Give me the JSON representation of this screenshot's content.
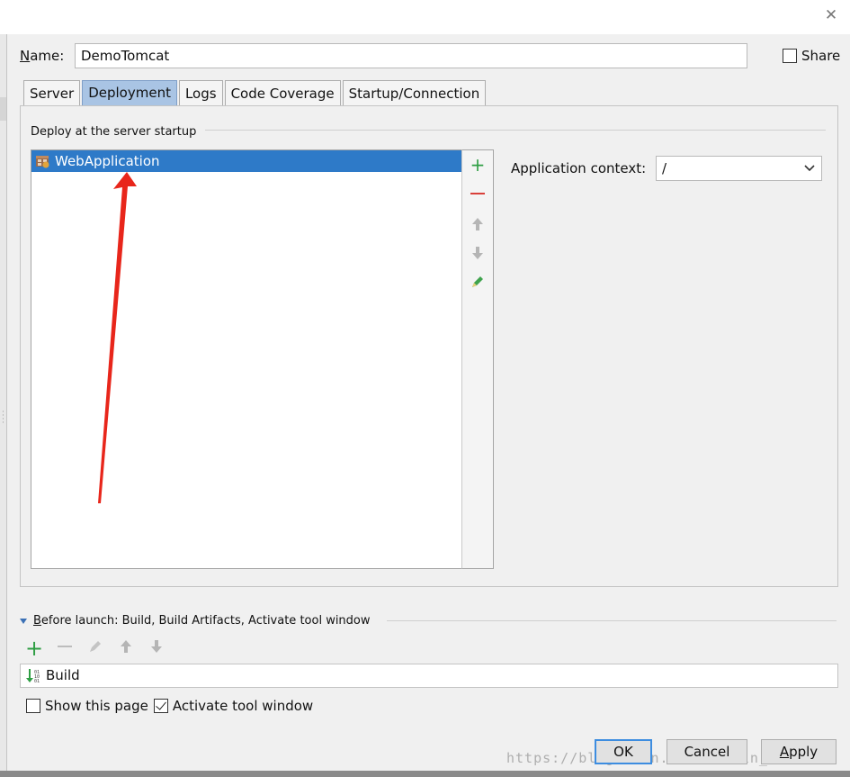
{
  "dialog": {
    "close_glyph": "✕"
  },
  "name_row": {
    "label_first": "N",
    "label_rest": "ame:",
    "value": "DemoTomcat",
    "share_label": "Share",
    "share_checked": false
  },
  "tabs": [
    {
      "label": "Server",
      "active": false
    },
    {
      "label": "Deployment",
      "active": true
    },
    {
      "label": "Logs",
      "active": false
    },
    {
      "label": "Code Coverage",
      "active": false
    },
    {
      "label": "Startup/Connection",
      "active": false
    }
  ],
  "deployment": {
    "section_title": "Deploy at the server startup",
    "items": [
      {
        "label": "WebApplication",
        "icon": "artifact-icon",
        "selected": true
      }
    ],
    "toolbar": [
      "add-icon",
      "remove-icon",
      "move-up-icon",
      "move-down-icon",
      "edit-icon"
    ],
    "context_label": "Application context:",
    "context_value": "/"
  },
  "before_launch": {
    "label_first": "B",
    "label_rest": "efore launch: Build, Build Artifacts, Activate tool window",
    "toolbar": [
      "add-icon",
      "remove-icon",
      "edit-icon",
      "move-up-icon",
      "move-down-icon"
    ],
    "tasks": [
      {
        "label": "Build",
        "icon": "build-icon"
      }
    ]
  },
  "options": {
    "show_page_label": "Show this page",
    "show_page_checked": false,
    "activate_label": "Activate tool window",
    "activate_checked": true
  },
  "buttons": {
    "ok": "OK",
    "cancel": "Cancel",
    "apply_first": "A",
    "apply_rest": "pply"
  },
  "watermark": "https://blog.csdn.net/weixin_4360994",
  "colors": {
    "selection": "#2e7ac8",
    "active_tab": "#a9c4e4",
    "add_green": "#2f9e44",
    "remove_red": "#d9403a",
    "annotation_arrow": "#e8261b",
    "ok_border": "#3d8de0"
  }
}
